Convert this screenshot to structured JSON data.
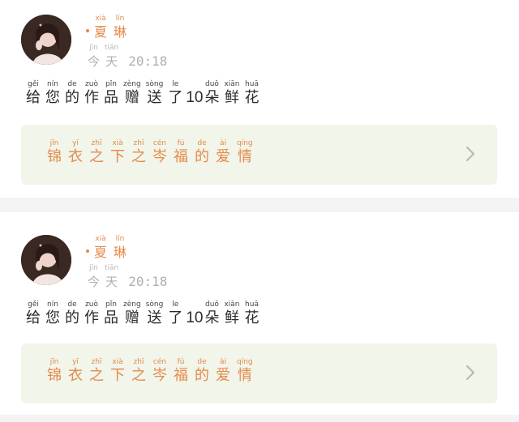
{
  "cards": [
    {
      "user": {
        "name": [
          {
            "char": "夏",
            "pinyin": "xià"
          },
          {
            "char": "琳",
            "pinyin": "lín"
          }
        ]
      },
      "time": {
        "day": [
          {
            "char": "今",
            "pinyin": "jīn"
          },
          {
            "char": "天",
            "pinyin": "tiān"
          }
        ],
        "clock": "20:18"
      },
      "message": {
        "before": [
          {
            "char": "给",
            "pinyin": "gěi"
          },
          {
            "char": "您",
            "pinyin": "nín"
          },
          {
            "char": "的",
            "pinyin": "de"
          },
          {
            "char": "作",
            "pinyin": "zuò"
          },
          {
            "char": "品",
            "pinyin": "pǐn"
          },
          {
            "char": "赠",
            "pinyin": "zèng"
          },
          {
            "char": "送",
            "pinyin": "sòng"
          },
          {
            "char": "了",
            "pinyin": "le"
          }
        ],
        "count": "10",
        "after": [
          {
            "char": "朵",
            "pinyin": "duǒ"
          },
          {
            "char": "鲜",
            "pinyin": "xiān"
          },
          {
            "char": "花",
            "pinyin": "huā"
          }
        ]
      },
      "work": {
        "title": [
          {
            "char": "锦",
            "pinyin": "jǐn"
          },
          {
            "char": "衣",
            "pinyin": "yī"
          },
          {
            "char": "之",
            "pinyin": "zhī"
          },
          {
            "char": "下",
            "pinyin": "xià"
          },
          {
            "char": "之",
            "pinyin": "zhī"
          },
          {
            "char": "岑",
            "pinyin": "cén"
          },
          {
            "char": "福",
            "pinyin": "fú"
          },
          {
            "char": "的",
            "pinyin": "de"
          },
          {
            "char": "爱",
            "pinyin": "ài"
          },
          {
            "char": "情",
            "pinyin": "qíng"
          }
        ]
      }
    },
    {
      "user": {
        "name": [
          {
            "char": "夏",
            "pinyin": "xià"
          },
          {
            "char": "琳",
            "pinyin": "lín"
          }
        ]
      },
      "time": {
        "day": [
          {
            "char": "今",
            "pinyin": "jīn"
          },
          {
            "char": "天",
            "pinyin": "tiān"
          }
        ],
        "clock": "20:18"
      },
      "message": {
        "before": [
          {
            "char": "给",
            "pinyin": "gěi"
          },
          {
            "char": "您",
            "pinyin": "nín"
          },
          {
            "char": "的",
            "pinyin": "de"
          },
          {
            "char": "作",
            "pinyin": "zuò"
          },
          {
            "char": "品",
            "pinyin": "pǐn"
          },
          {
            "char": "赠",
            "pinyin": "zèng"
          },
          {
            "char": "送",
            "pinyin": "sòng"
          },
          {
            "char": "了",
            "pinyin": "le"
          }
        ],
        "count": "10",
        "after": [
          {
            "char": "朵",
            "pinyin": "duǒ"
          },
          {
            "char": "鲜",
            "pinyin": "xiān"
          },
          {
            "char": "花",
            "pinyin": "huā"
          }
        ]
      },
      "work": {
        "title": [
          {
            "char": "锦",
            "pinyin": "jǐn"
          },
          {
            "char": "衣",
            "pinyin": "yī"
          },
          {
            "char": "之",
            "pinyin": "zhī"
          },
          {
            "char": "下",
            "pinyin": "xià"
          },
          {
            "char": "之",
            "pinyin": "zhī"
          },
          {
            "char": "岑",
            "pinyin": "cén"
          },
          {
            "char": "福",
            "pinyin": "fú"
          },
          {
            "char": "的",
            "pinyin": "de"
          },
          {
            "char": "爱",
            "pinyin": "ài"
          },
          {
            "char": "情",
            "pinyin": "qíng"
          }
        ]
      }
    }
  ],
  "icons": {
    "chevron": "chevron-right-icon",
    "avatar": "user-avatar-photo"
  },
  "colors": {
    "accent": "#e58a4a",
    "link_background": "#f1f5ea",
    "muted": "#b0b0b0",
    "text": "#2a2a2a",
    "separator": "#f4f4f4"
  }
}
